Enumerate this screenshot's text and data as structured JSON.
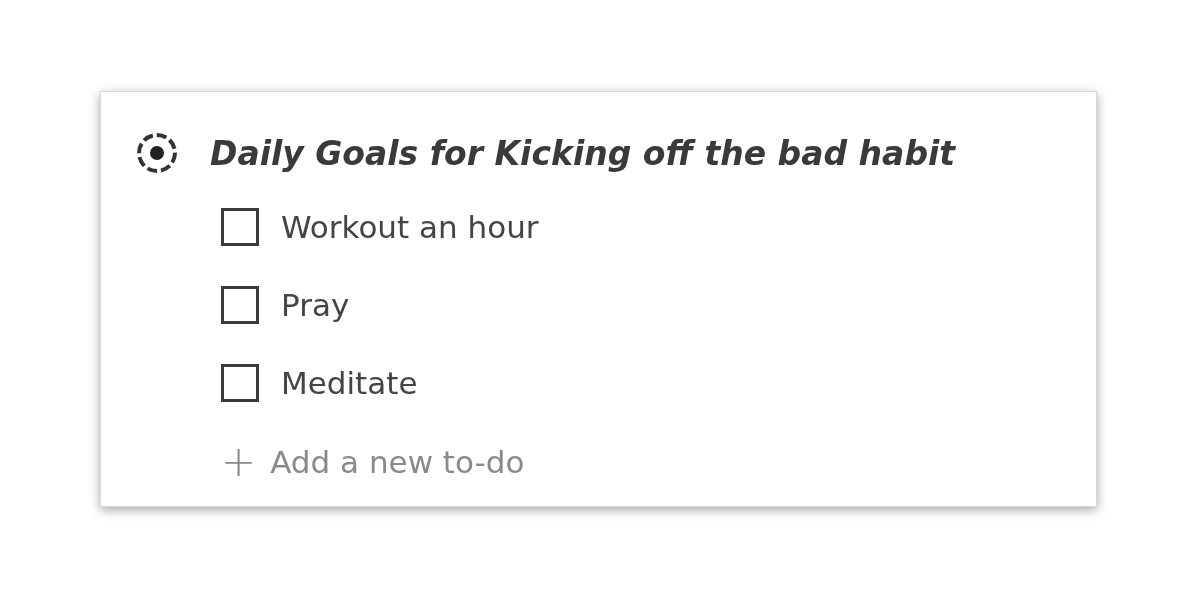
{
  "list": {
    "title": "Daily Goals for Kicking off the bad habit",
    "items": [
      {
        "label": "Workout an hour",
        "checked": false
      },
      {
        "label": "Pray",
        "checked": false
      },
      {
        "label": "Meditate",
        "checked": false
      }
    ],
    "add_button": {
      "icon": "+",
      "label": "Add a new to-do"
    }
  }
}
